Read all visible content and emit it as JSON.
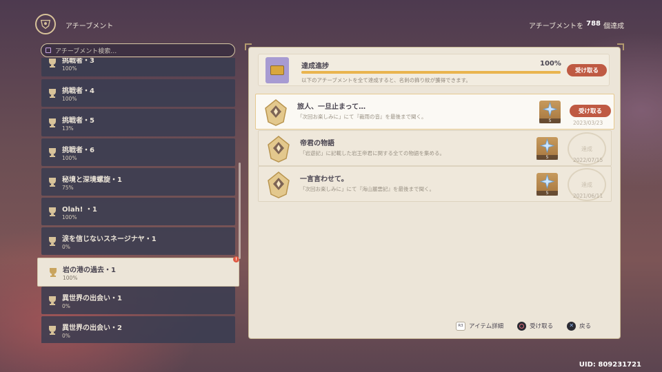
{
  "header": {
    "title": "アチーブメント",
    "count_prefix": "アチーブメントを",
    "count_value": "788",
    "count_suffix": "個達成"
  },
  "search": {
    "placeholder": "アチーブメント検索…"
  },
  "categories": [
    {
      "name": "挑戦者・3",
      "percent": "100%"
    },
    {
      "name": "挑戦者・4",
      "percent": "100%"
    },
    {
      "name": "挑戦者・5",
      "percent": "13%"
    },
    {
      "name": "挑戦者・6",
      "percent": "100%"
    },
    {
      "name": "秘境と深境螺旋・1",
      "percent": "75%"
    },
    {
      "name": "Olah! ・1",
      "percent": "100%"
    },
    {
      "name": "涙を信じないスネージナヤ・1",
      "percent": "0%"
    },
    {
      "name": "岩の港の過去・1",
      "percent": "100%",
      "selected": true,
      "badge": "!"
    },
    {
      "name": "異世界の出会い・1",
      "percent": "0%"
    },
    {
      "name": "異世界の出会い・2",
      "percent": "0%"
    }
  ],
  "progress": {
    "title": "達成進捗",
    "percent_label": "100%",
    "fill": 1.0,
    "description": "以下のアチーブメントを全て達成すると、名刺の飾り紋が獲得できます。",
    "claim_label": "受け取る"
  },
  "achievements": [
    {
      "name": "旅人、一旦止まって…",
      "description": "「次回お楽しみに」にて『裁雨の音』を最後まで聞く。",
      "reward_count": "5",
      "claim_label": "受け取る",
      "date": "2023/03/23"
    },
    {
      "name": "帝君の物語",
      "description": "「岩遊記」に記載した岩王帝君に関する全ての物語を集める。",
      "reward_count": "5",
      "stamp": "達成",
      "date": "2022/07/15"
    },
    {
      "name": "一言言わせて。",
      "description": "「次回お楽しみに」にて『海山麗雲記』を最後まで聞く。",
      "reward_count": "5",
      "stamp": "達成",
      "date": "2021/06/11"
    }
  ],
  "footer": {
    "r3_label": "R3",
    "item_detail": "アイテム詳細",
    "claim": "受け取る",
    "back": "戻る"
  },
  "uid": "UID: 809231721",
  "colors": {
    "accent": "#bf5a43",
    "panel": "#ece5d8",
    "progress_fill": "#e9b44e"
  }
}
